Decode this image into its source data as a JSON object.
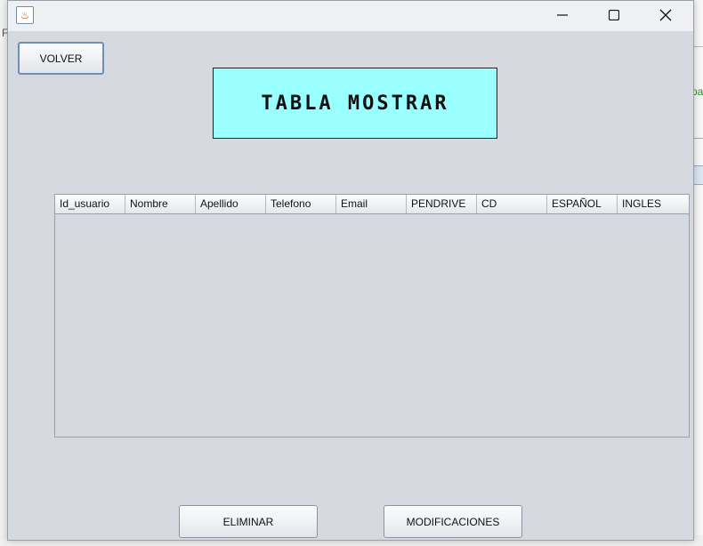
{
  "window": {
    "title": "",
    "controls": {
      "minimize": "—",
      "maximize": "☐",
      "close": "✕"
    }
  },
  "buttons": {
    "volver": "VOLVER",
    "eliminar": "ELIMINAR",
    "modificaciones": "MODIFICACIONES"
  },
  "title_label": "TABLA MOSTRAR",
  "table": {
    "columns": [
      "Id_usuario",
      "Nombre",
      "Apellido",
      "Telefono",
      "Email",
      "PENDRIVE",
      "CD",
      "ESPAÑOL",
      "INGLES"
    ],
    "rows": []
  },
  "background": {
    "fragment_left_1": "F",
    "fragment_right_1": "pa"
  },
  "colors": {
    "title_box": "#99ffff",
    "window_bg": "#d6d9df",
    "focus_border": "#6f8fb8"
  }
}
